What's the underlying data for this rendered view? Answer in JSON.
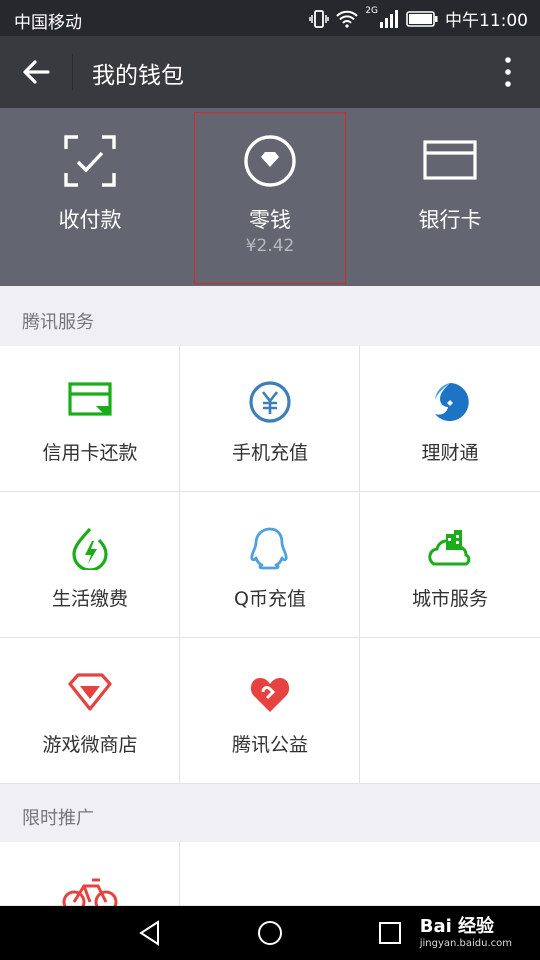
{
  "statusbar": {
    "carrier": "中国移动",
    "network": "2G",
    "time": "中午11:00"
  },
  "header": {
    "title": "我的钱包"
  },
  "top_actions": [
    {
      "label": "收付款"
    },
    {
      "label": "零钱",
      "sub": "¥2.42"
    },
    {
      "label": "银行卡"
    }
  ],
  "sections": {
    "tencent": {
      "title": "腾讯服务"
    },
    "promo": {
      "title": "限时推广"
    }
  },
  "services": [
    {
      "label": "信用卡还款",
      "icon": "credit-card-repay-icon",
      "color": "#1aad19"
    },
    {
      "label": "手机充值",
      "icon": "yuan-coin-icon",
      "color": "#3d7fb6"
    },
    {
      "label": "理财通",
      "icon": "licaitong-icon",
      "color": "#1d74c4"
    },
    {
      "label": "生活缴费",
      "icon": "bolt-drop-icon",
      "color": "#1aad19"
    },
    {
      "label": "Q币充值",
      "icon": "qq-penguin-icon",
      "color": "#4da2d9"
    },
    {
      "label": "城市服务",
      "icon": "city-cloud-icon",
      "color": "#1aad19"
    },
    {
      "label": "游戏微商店",
      "icon": "diamond-icon",
      "color": "#e64340"
    },
    {
      "label": "腾讯公益",
      "icon": "charity-heart-icon",
      "color": "#e64340"
    }
  ],
  "watermark": {
    "brand": "Bai 经验",
    "url": "jingyan.baidu.com"
  },
  "colors": {
    "accent": "#1aad19",
    "header_bg": "#393a3f",
    "wallet_bg": "#636670",
    "highlight": "#d32a2a"
  }
}
